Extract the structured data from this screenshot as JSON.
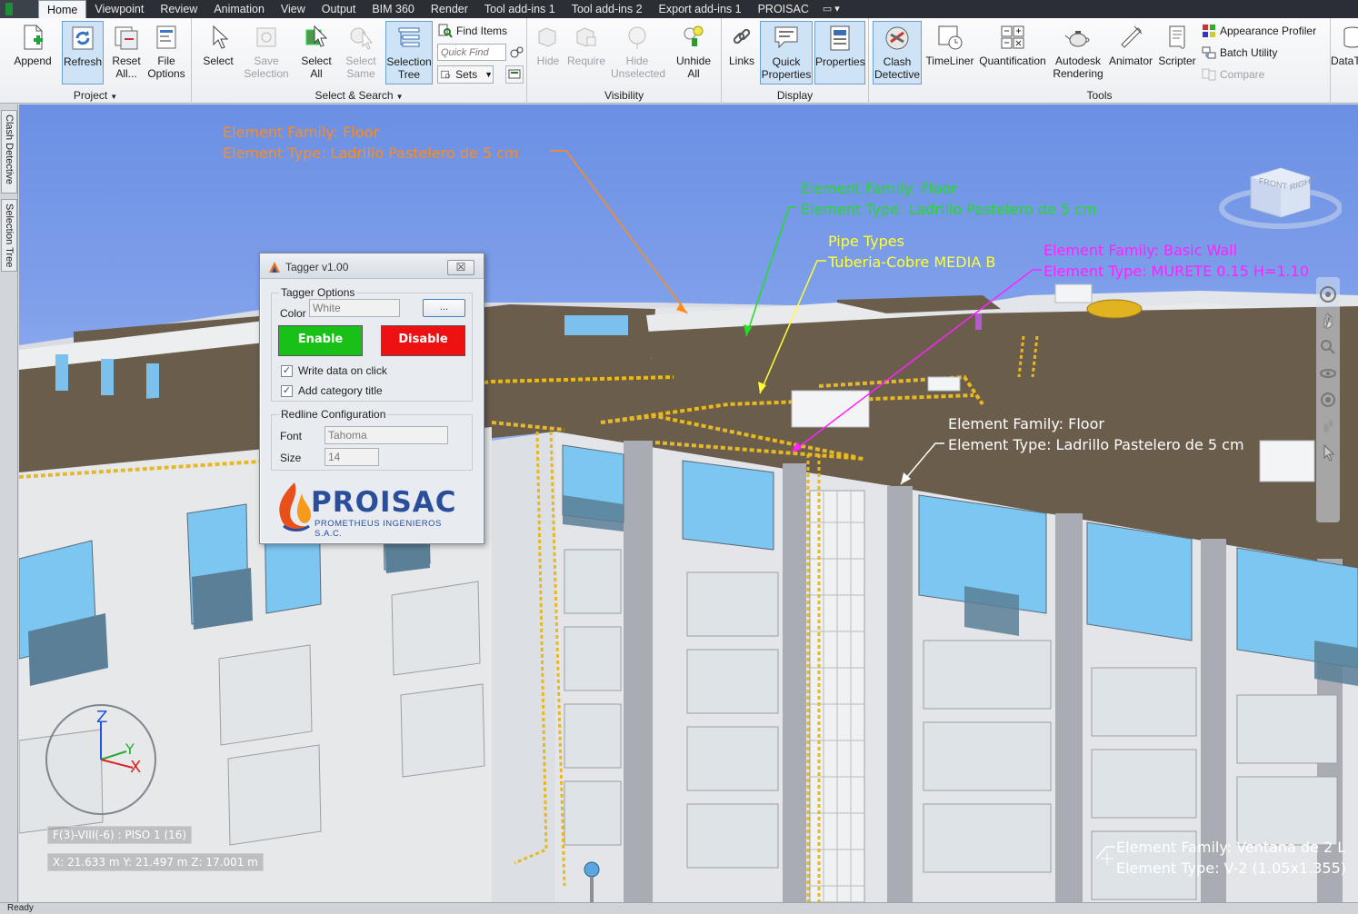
{
  "menu": {
    "tabs": [
      "Home",
      "Viewpoint",
      "Review",
      "Animation",
      "View",
      "Output",
      "BIM 360",
      "Render",
      "Tool add-ins 1",
      "Tool add-ins 2",
      "Export add-ins 1",
      "PROISAC"
    ],
    "active_tab": "Home",
    "extra": "▭ ▾"
  },
  "ribbon": {
    "project": {
      "label": "Project",
      "append": "Append",
      "refresh": "Refresh",
      "reset_all": "Reset\nAll...",
      "file_options": "File\nOptions"
    },
    "select_search": {
      "label": "Select & Search",
      "select": "Select",
      "save_selection": "Save\nSelection",
      "select_all": "Select\nAll",
      "select_same": "Select\nSame",
      "selection_tree": "Selection\nTree",
      "find_items": "Find Items",
      "quick_find_placeholder": "Quick Find",
      "sets": "Sets"
    },
    "visibility": {
      "label": "Visibility",
      "hide": "Hide",
      "require": "Require",
      "hide_unselected": "Hide\nUnselected",
      "unhide_all": "Unhide\nAll"
    },
    "display": {
      "label": "Display",
      "links": "Links",
      "quick_properties": "Quick\nProperties",
      "properties": "Properties"
    },
    "tools": {
      "label": "Tools",
      "clash_detective": "Clash\nDetective",
      "timeliner": "TimeLiner",
      "quantification": "Quantification",
      "autodesk_rendering": "Autodesk\nRendering",
      "animator": "Animator",
      "scripter": "Scripter",
      "appearance_profiler": "Appearance Profiler",
      "batch_utility": "Batch Utility",
      "compare": "Compare",
      "datatools": "DataT"
    }
  },
  "side_tabs": [
    "Clash Detective",
    "Selection Tree"
  ],
  "annotations": [
    {
      "line1": "Element Family: Floor",
      "line2": "Element Type: Ladrillo Pastelero de 5 cm",
      "color": "#ff8c1a"
    },
    {
      "line1": "Element Family: Floor",
      "line2": "Element Type: Ladrillo Pastelero de 5 cm",
      "color": "#22dd22"
    },
    {
      "line1": "Pipe Types",
      "line2": "Tuberia-Cobre MEDIA B",
      "color": "#ffff33"
    },
    {
      "line1": "Element Family: Basic Wall",
      "line2": "Element Type: MURETE 0.15 H=1.10",
      "color": "#ff22ff"
    },
    {
      "line1": "Element Family: Floor",
      "line2": "Element Type: Ladrillo Pastelero de 5 cm",
      "color": "#ffffff"
    },
    {
      "line1": "Element Family: Ventana de 2 L",
      "line2": "Element Type: V-2 (1.05x1.355)",
      "color": "#ffffff"
    }
  ],
  "viewcube": {
    "front": "FRONT",
    "right": "RIGHT"
  },
  "axes": {
    "z": "Z",
    "y": "Y",
    "x": "X"
  },
  "status": {
    "element_path": "F(3)-VIII(-6) : PISO 1 (16)",
    "coordinates": "X: 21.633 m  Y: 21.497 m  Z: 17.001 m",
    "ready": "Ready"
  },
  "tagger": {
    "title": "Tagger v1.00",
    "close": "☒",
    "options_legend": "Tagger Options",
    "color_label": "Color",
    "color_value": "White",
    "dots": "...",
    "enable": "Enable",
    "disable": "Disable",
    "write_data": "Write data on click",
    "add_category": "Add category title",
    "write_data_checked": true,
    "add_category_checked": true,
    "redline_legend": "Redline Configuration",
    "font_label": "Font",
    "font_value": "Tahoma",
    "size_label": "Size",
    "size_value": "14",
    "logo_word": "PROISAC",
    "logo_sub": "PROMETHEUS INGENIEROS S.A.C."
  },
  "colors": {
    "enable": "#18c018",
    "disable": "#ee1111",
    "roof": "#6b5d4c",
    "sky": "#7a9be8"
  }
}
